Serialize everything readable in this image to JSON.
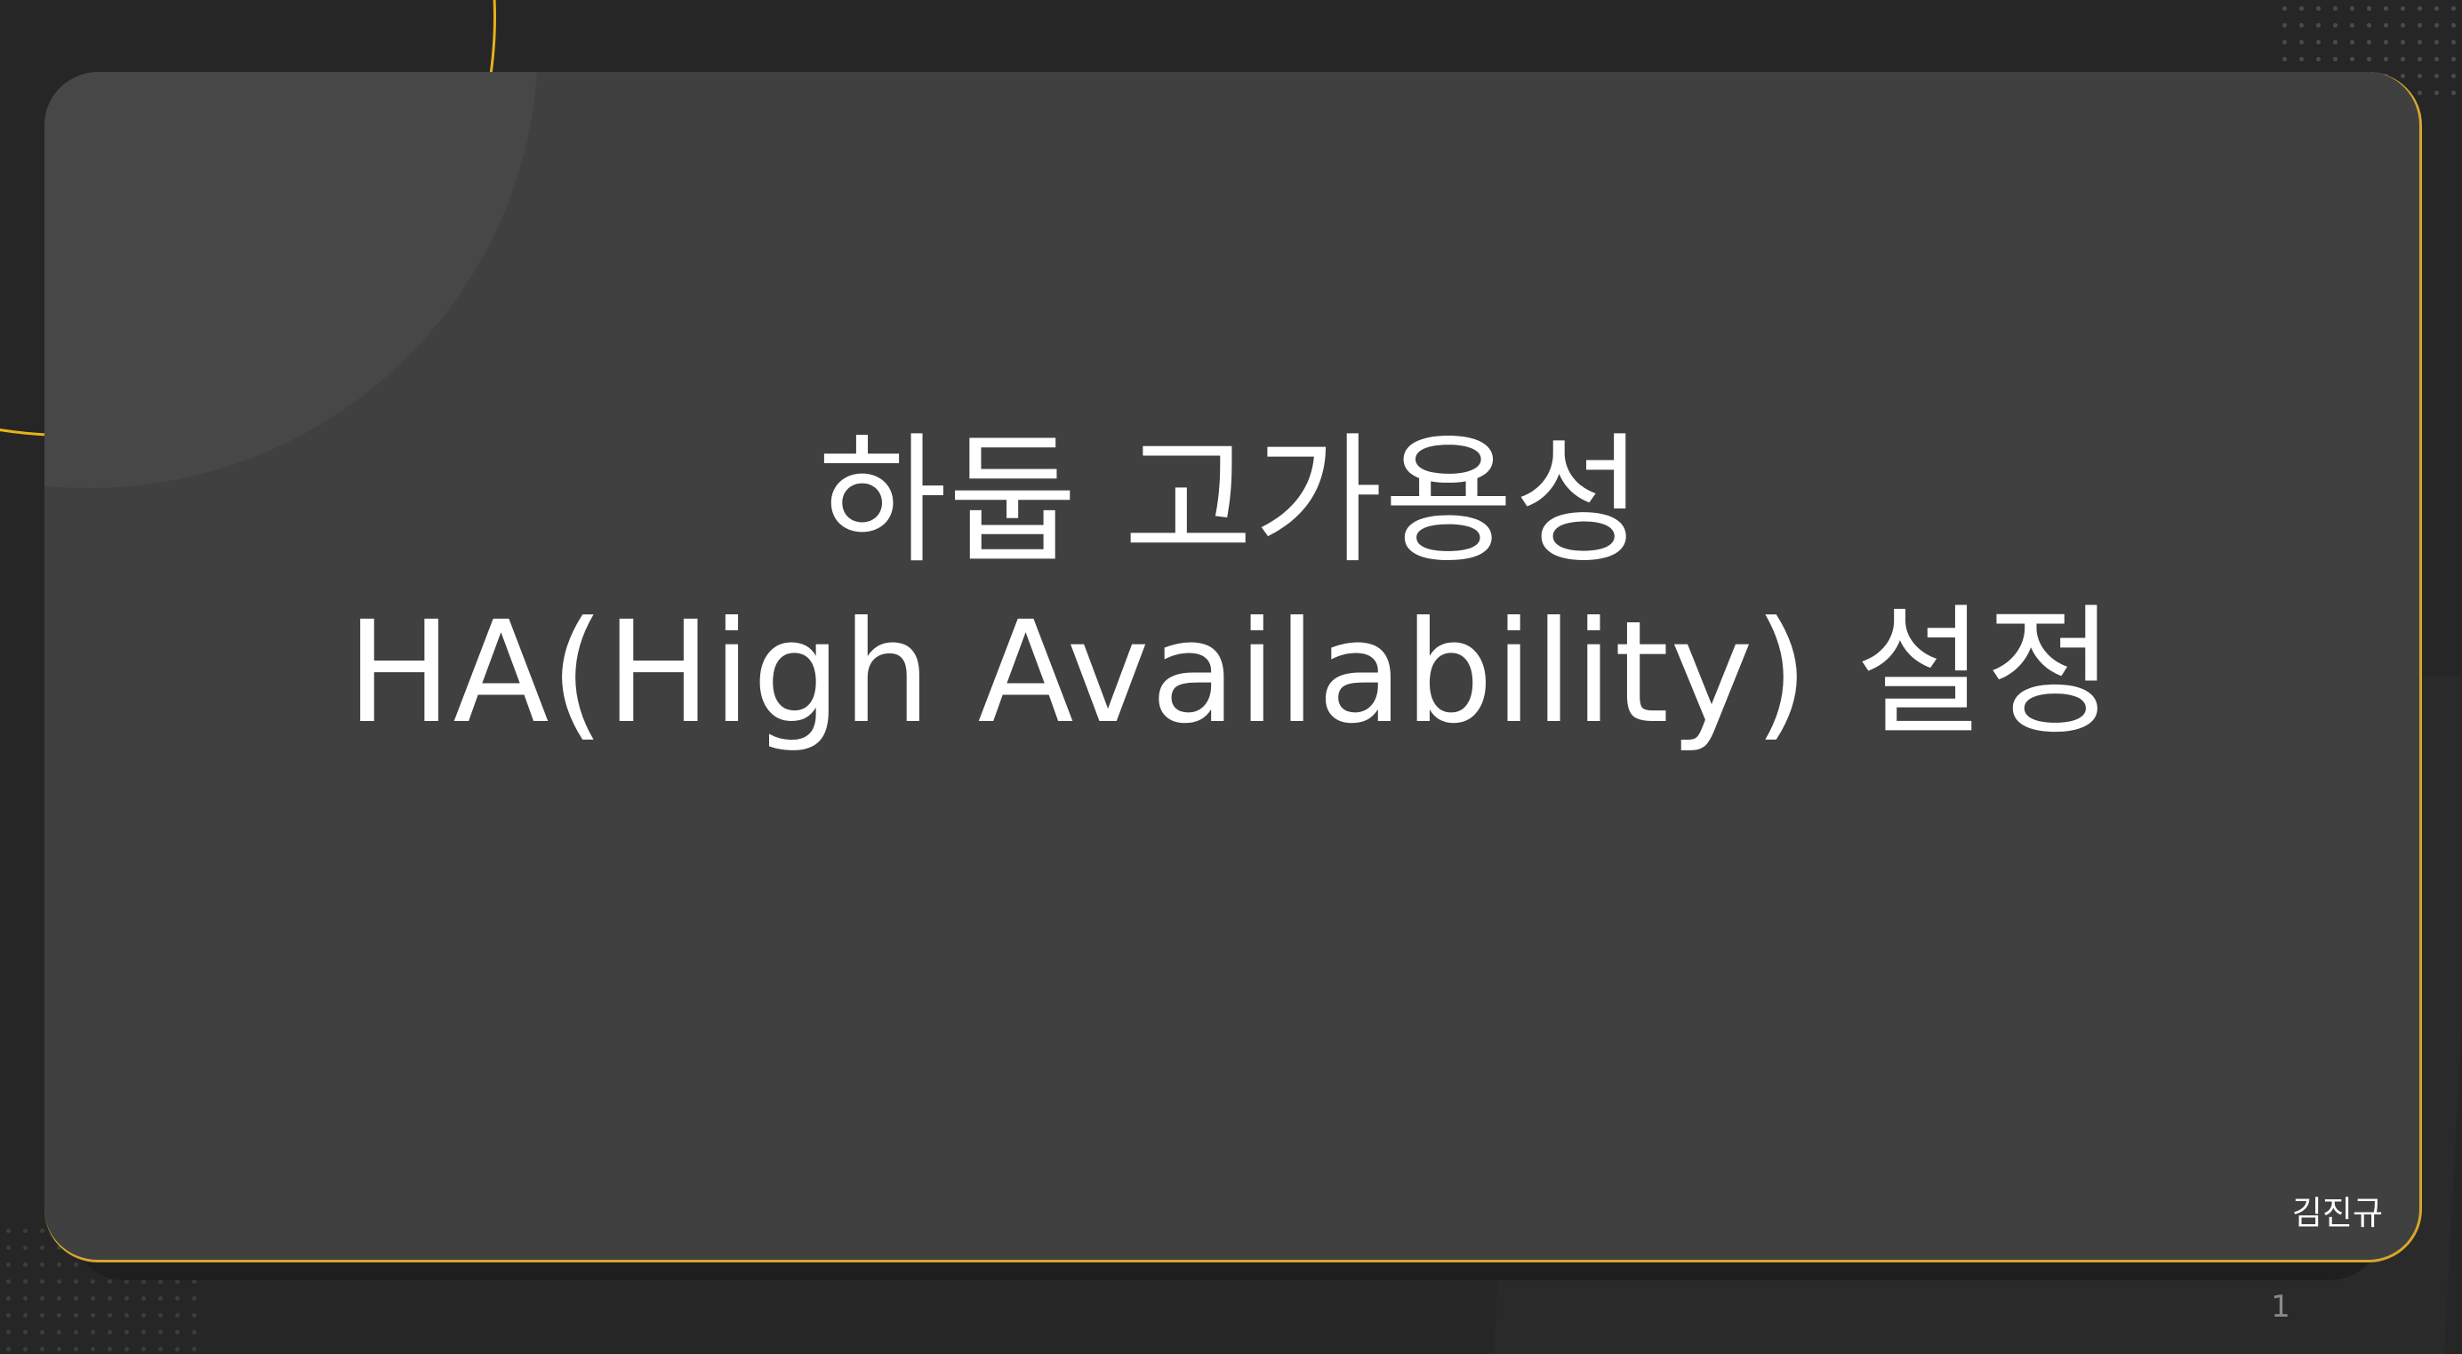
{
  "slide": {
    "title_line1": "하둡 고가용성",
    "title_line2": "HA(High Availability) 설정",
    "author": "김진규",
    "page_number": "1"
  },
  "colors": {
    "background": "#262626",
    "card": "#404040",
    "accent": "#e6b317",
    "text": "#ffffff",
    "muted_text": "#8a8a8a"
  }
}
